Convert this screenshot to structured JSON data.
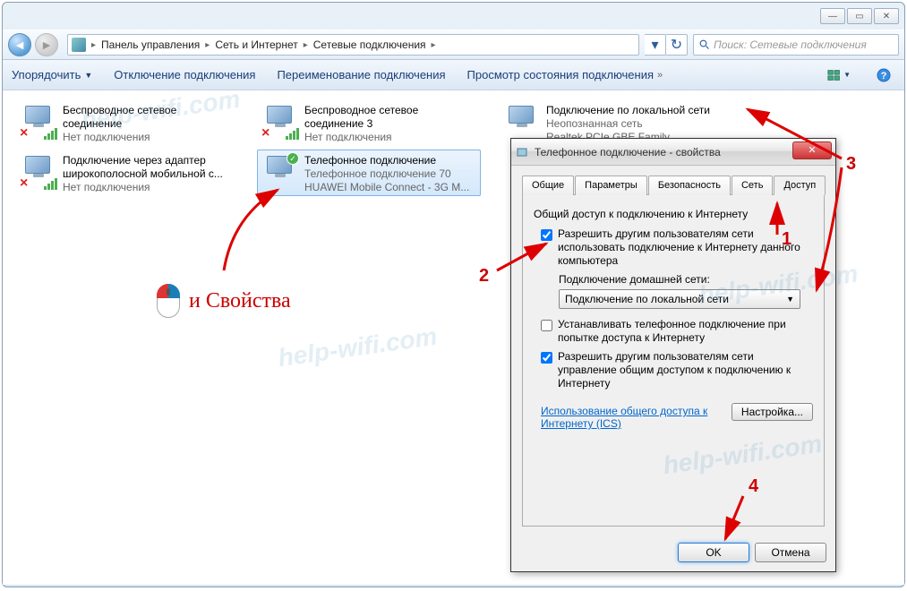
{
  "breadcrumb": {
    "item1": "Панель управления",
    "item2": "Сеть и Интернет",
    "item3": "Сетевые подключения"
  },
  "search": {
    "placeholder": "Поиск: Сетевые подключения"
  },
  "commands": {
    "organize": "Упорядочить",
    "disable": "Отключение подключения",
    "rename": "Переименование подключения",
    "status": "Просмотр состояния подключения"
  },
  "connections": {
    "wifi1": {
      "title": "Беспроводное сетевое соединение",
      "status": "Нет подключения"
    },
    "wifi2": {
      "title": "Беспроводное сетевое соединение 3",
      "status": "Нет подключения"
    },
    "lan": {
      "title": "Подключение по локальной сети",
      "status": "Неопознанная сеть",
      "adapter": "Realtek PCIe GBE Family Controller"
    },
    "wwan": {
      "title": "Подключение через адаптер широкополосной мобильной с...",
      "status": "Нет подключения"
    },
    "dialup": {
      "title": "Телефонное подключение",
      "status": "Телефонное подключение 70",
      "adapter": "HUAWEI Mobile Connect - 3G M..."
    }
  },
  "dialog": {
    "title": "Телефонное подключение - свойства",
    "tabs": {
      "general": "Общие",
      "params": "Параметры",
      "security": "Безопасность",
      "network": "Сеть",
      "sharing": "Доступ"
    },
    "groupTitle": "Общий доступ к подключению к Интернету",
    "chk1": "Разрешить другим пользователям сети использовать подключение к Интернету данного компьютера",
    "homeLabel": "Подключение домашней сети:",
    "comboValue": "Подключение по локальной сети",
    "chk2": "Устанавливать телефонное подключение при попытке доступа к Интернету",
    "chk3": "Разрешить другим пользователям сети управление общим доступом к подключению к Интернету",
    "link": "Использование общего доступа к Интернету (ICS)",
    "settingsBtn": "Настройка...",
    "ok": "OK",
    "cancel": "Отмена"
  },
  "annotations": {
    "propsText": "и Свойства",
    "n1": "1",
    "n2": "2",
    "n3": "3",
    "n4": "4"
  },
  "watermark": "help-wifi.com"
}
